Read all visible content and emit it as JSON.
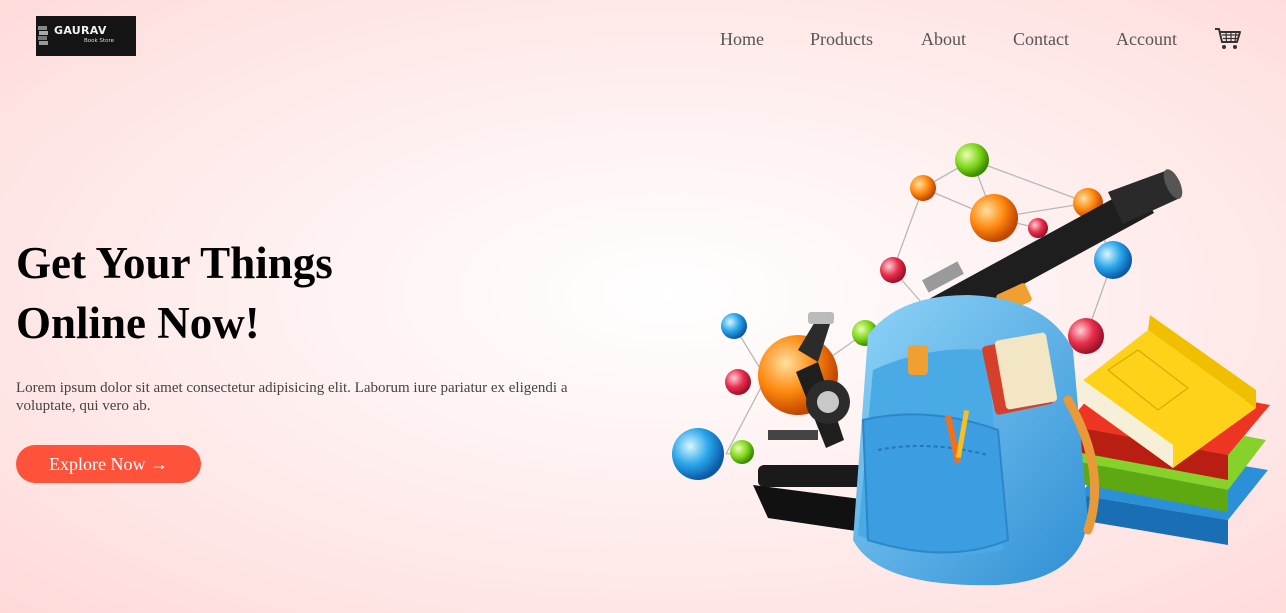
{
  "logo": {
    "title": "GAURAV",
    "subtitle": "Book Store"
  },
  "nav": {
    "items": [
      {
        "label": "Home"
      },
      {
        "label": "Products"
      },
      {
        "label": "About"
      },
      {
        "label": "Contact"
      },
      {
        "label": "Account"
      }
    ],
    "cart_icon": "shopping-cart-icon"
  },
  "hero": {
    "title_line1": "Get Your Things",
    "title_line2": "Online Now!",
    "text": "Lorem ipsum dolor sit amet consectetur adipisicing elit. Laborum iure pariatur ex eligendi a voluptate, qui vero ab.",
    "cta_label": "Explore Now →",
    "image_icon": "school-supplies-illustration"
  },
  "colors": {
    "accent": "#ff523b",
    "background": "#ffe4e4",
    "nav_text": "#555555",
    "title_text": "#000000"
  }
}
